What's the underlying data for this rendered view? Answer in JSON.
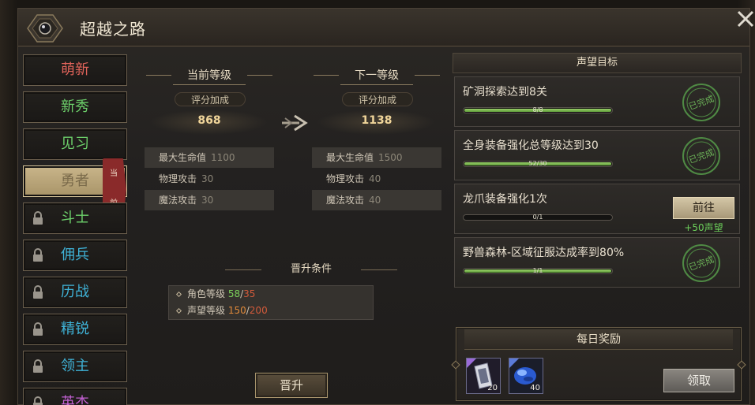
{
  "window": {
    "title": "超越之路"
  },
  "ranks": [
    {
      "label": "萌新",
      "color": "#e0635a",
      "locked": false,
      "active": false
    },
    {
      "label": "新秀",
      "color": "#6ccf6a",
      "locked": false,
      "active": false
    },
    {
      "label": "见习",
      "color": "#6ccf6a",
      "locked": false,
      "active": false
    },
    {
      "label": "勇者",
      "color": "#b8a27a",
      "locked": false,
      "active": true
    },
    {
      "label": "斗士",
      "color": "#6ccf6a",
      "locked": true,
      "active": false
    },
    {
      "label": "佣兵",
      "color": "#3fb3d8",
      "locked": true,
      "active": false
    },
    {
      "label": "历战",
      "color": "#3fb3d8",
      "locked": true,
      "active": false
    },
    {
      "label": "精锐",
      "color": "#3fb3d8",
      "locked": true,
      "active": false
    },
    {
      "label": "领主",
      "color": "#3fb3d8",
      "locked": true,
      "active": false
    },
    {
      "label": "英杰",
      "color": "#c060d0",
      "locked": true,
      "active": false
    }
  ],
  "current_badge": "当前",
  "current_level": {
    "header": "当前等级",
    "score_label": "评分加成",
    "score": "868",
    "stats": [
      {
        "name": "最大生命值",
        "value": "1100"
      },
      {
        "name": "物理攻击",
        "value": "30"
      },
      {
        "name": "魔法攻击",
        "value": "30"
      }
    ]
  },
  "next_level": {
    "header": "下一等级",
    "score_label": "评分加成",
    "score": "1138",
    "stats": [
      {
        "name": "最大生命值",
        "value": "1500"
      },
      {
        "name": "物理攻击",
        "value": "40"
      },
      {
        "name": "魔法攻击",
        "value": "40"
      }
    ]
  },
  "promotion": {
    "header": "晋升条件",
    "conditions": [
      {
        "label": "角色等级",
        "have": "58",
        "sep": "/",
        "need": "35"
      },
      {
        "label": "声望等级",
        "have": "150",
        "sep": "/",
        "need": "200"
      }
    ],
    "button": "晋升"
  },
  "reputation": {
    "header": "声望目标",
    "tasks": [
      {
        "name": "矿洞探索达到8关",
        "progress_text": "8/8",
        "progress": 1.0,
        "done": true,
        "stamp": "已完成"
      },
      {
        "name": "全身装备强化总等级达到30",
        "progress_text": "52/30",
        "progress": 1.0,
        "done": true,
        "stamp": "已完成"
      },
      {
        "name": "龙爪装备强化1次",
        "progress_text": "0/1",
        "progress": 0.0,
        "done": false,
        "button": "前往",
        "reward": "+50声望"
      },
      {
        "name": "野兽森林-区域征服达成率到80%",
        "progress_text": "1/1",
        "progress": 1.0,
        "done": true,
        "stamp": "已完成"
      }
    ]
  },
  "daily_reward": {
    "header": "每日奖励",
    "items": [
      {
        "icon": "scroll-card-icon",
        "count": "20"
      },
      {
        "icon": "blue-gem-icon",
        "count": "40"
      }
    ],
    "button": "领取"
  }
}
